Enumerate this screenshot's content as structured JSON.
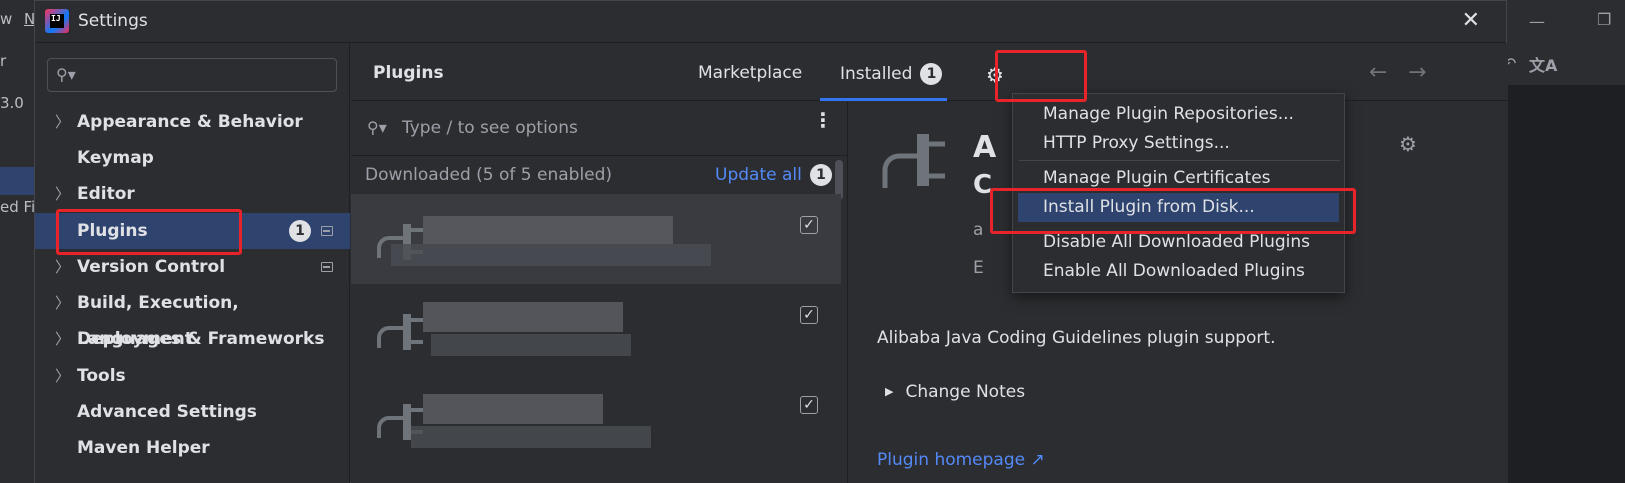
{
  "background": {
    "left_fragments": [
      "w",
      "N",
      "r",
      "3.0",
      "ed Fi"
    ],
    "right_icons": [
      "minimize-icon",
      "undo-icon",
      "translate-icon"
    ]
  },
  "window": {
    "title": "Settings",
    "logo_text": "IJ"
  },
  "sidebar": {
    "search_placeholder": "",
    "items": [
      {
        "label": "Appearance & Behavior",
        "expandable": true
      },
      {
        "label": "Keymap",
        "expandable": false
      },
      {
        "label": "Editor",
        "expandable": true
      },
      {
        "label": "Plugins",
        "expandable": false,
        "selected": true,
        "badge": "1"
      },
      {
        "label": "Version Control",
        "expandable": true
      },
      {
        "label": "Build, Execution, Deployment",
        "expandable": true
      },
      {
        "label": "Languages & Frameworks",
        "expandable": true
      },
      {
        "label": "Tools",
        "expandable": true
      },
      {
        "label": "Advanced Settings",
        "expandable": false
      },
      {
        "label": "Maven Helper",
        "expandable": false
      }
    ]
  },
  "header": {
    "title": "Plugins",
    "tabs": [
      {
        "label": "Marketplace",
        "active": false
      },
      {
        "label": "Installed",
        "active": true,
        "badge": "1"
      }
    ]
  },
  "plugin_list": {
    "search_placeholder": "Type / to see options",
    "group_label": "Downloaded (5 of 5 enabled)",
    "update_all_label": "Update all",
    "update_badge": "1",
    "rows": [
      {
        "checked": true,
        "selected": true
      },
      {
        "checked": true,
        "selected": false
      },
      {
        "checked": true,
        "selected": false
      }
    ]
  },
  "details": {
    "description": "Alibaba Java Coding Guidelines plugin support.",
    "change_notes_label": "Change Notes",
    "homepage_label": "Plugin homepage ↗",
    "partial_title": "A",
    "partial_line1": "C",
    "partial_line2": "a",
    "partial_line3": "E"
  },
  "gear_menu": {
    "items": [
      "Manage Plugin Repositories...",
      "HTTP Proxy Settings...",
      "Manage Plugin Certificates",
      "Install Plugin from Disk...",
      "Disable All Downloaded Plugins",
      "Enable All Downloaded Plugins"
    ],
    "highlighted_index": 3
  },
  "colors": {
    "accent": "#3574f0",
    "selection": "#2e436e",
    "highlight_box": "#e8242a",
    "link": "#548af7"
  }
}
